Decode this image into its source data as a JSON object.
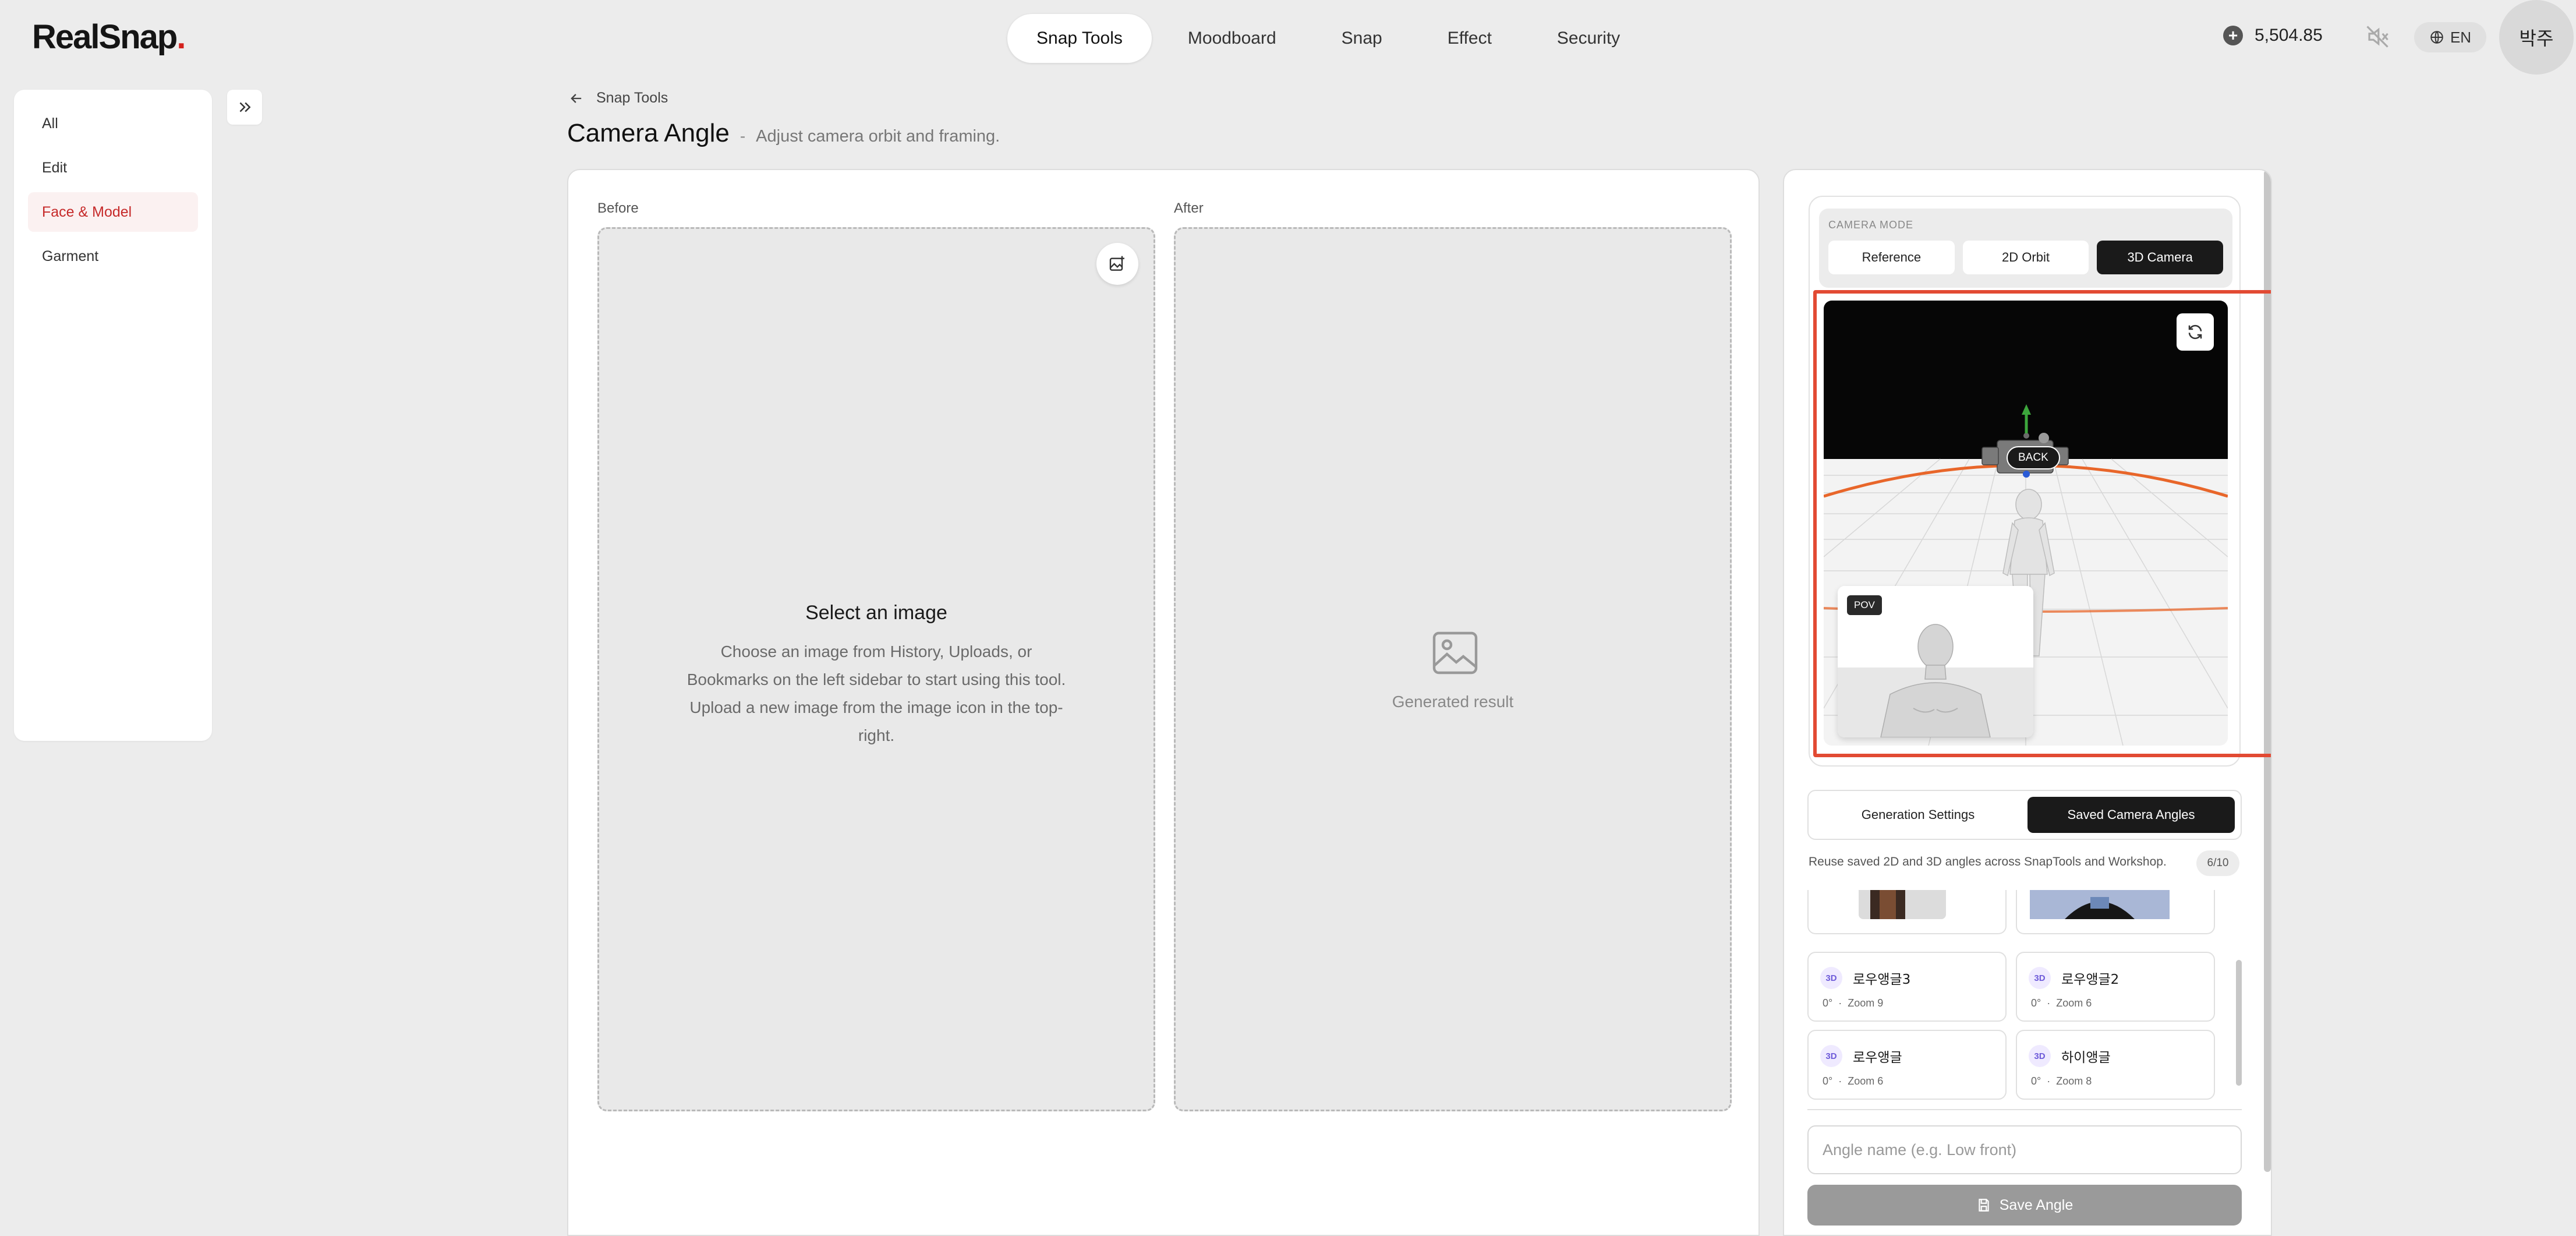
{
  "brand": {
    "name": "RealSnap",
    "dot": "."
  },
  "nav": {
    "tabs": [
      {
        "label": "Snap Tools",
        "active": true
      },
      {
        "label": "Moodboard",
        "active": false
      },
      {
        "label": "Snap",
        "active": false
      },
      {
        "label": "Effect",
        "active": false
      },
      {
        "label": "Security",
        "active": false
      }
    ]
  },
  "header_right": {
    "credits": "5,504.85",
    "credits_icon": "plus-circle-icon",
    "mute_icon": "mute-icon",
    "language": "EN",
    "user_name": "박주"
  },
  "sidebar": {
    "items": [
      {
        "label": "All",
        "active": false
      },
      {
        "label": "Edit",
        "active": false
      },
      {
        "label": "Face & Model",
        "active": true
      },
      {
        "label": "Garment",
        "active": false
      }
    ],
    "accent_color": "#c62a2a"
  },
  "breadcrumb": {
    "label": "Snap Tools"
  },
  "page": {
    "title": "Camera Angle",
    "separator": "-",
    "subtitle": "Adjust camera orbit and framing."
  },
  "before": {
    "label": "Before",
    "empty_title": "Select an image",
    "empty_description": "Choose an image from History, Uploads, or Bookmarks on the left sidebar to start using this tool. Upload a new image from the image icon in the top-right."
  },
  "after": {
    "label": "After",
    "placeholder": "Generated result"
  },
  "camera": {
    "mode_label": "CAMERA MODE",
    "modes": [
      {
        "label": "Reference",
        "active": false
      },
      {
        "label": "2D Orbit",
        "active": false
      },
      {
        "label": "3D Camera",
        "active": true
      }
    ],
    "viewport": {
      "back_label": "BACK",
      "pov_label": "POV"
    }
  },
  "panel_tabs": [
    {
      "label": "Generation Settings",
      "active": false
    },
    {
      "label": "Saved Camera Angles",
      "active": true
    }
  ],
  "saved": {
    "description": "Reuse saved 2D and 3D angles across SnapTools and Workshop.",
    "count": "6/10",
    "angles": [
      {
        "badge": "3D",
        "name": "로우앵글3",
        "angle": "0°",
        "zoom": "Zoom 9"
      },
      {
        "badge": "3D",
        "name": "로우앵글2",
        "angle": "0°",
        "zoom": "Zoom 6"
      },
      {
        "badge": "3D",
        "name": "로우앵글",
        "angle": "0°",
        "zoom": "Zoom 6"
      },
      {
        "badge": "3D",
        "name": "하이앵글",
        "angle": "0°",
        "zoom": "Zoom 8"
      }
    ]
  },
  "angle_form": {
    "placeholder": "Angle name (e.g. Low front)",
    "value": "",
    "save_label": "Save Angle"
  }
}
